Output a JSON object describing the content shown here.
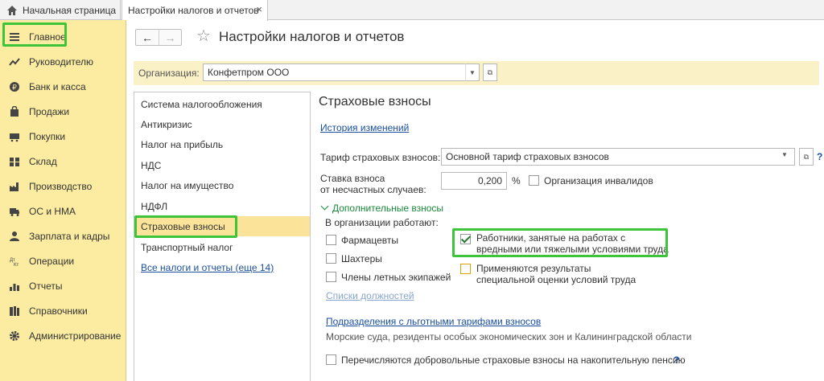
{
  "tabs": {
    "home_label": "Начальная страница",
    "active_label": "Настройки налогов и отчетов",
    "close_glyph": "×"
  },
  "sidebar": {
    "items": [
      {
        "label": "Главное",
        "icon": "menu-lines-icon"
      },
      {
        "label": "Руководителю",
        "icon": "trend-icon"
      },
      {
        "label": "Банк и касса",
        "icon": "coin-icon"
      },
      {
        "label": "Продажи",
        "icon": "bag-icon"
      },
      {
        "label": "Покупки",
        "icon": "cart-icon"
      },
      {
        "label": "Склад",
        "icon": "warehouse-icon"
      },
      {
        "label": "Производство",
        "icon": "factory-icon"
      },
      {
        "label": "ОС и НМА",
        "icon": "truck-icon"
      },
      {
        "label": "Зарплата и кадры",
        "icon": "person-icon"
      },
      {
        "label": "Операции",
        "icon": "operations-icon"
      },
      {
        "label": "Отчеты",
        "icon": "bar-chart-icon"
      },
      {
        "label": "Справочники",
        "icon": "books-icon"
      },
      {
        "label": "Администрирование",
        "icon": "gear-icon"
      }
    ]
  },
  "header": {
    "back_glyph": "←",
    "forward_glyph": "→",
    "star_glyph": "☆",
    "title": "Настройки налогов и отчетов"
  },
  "org": {
    "label": "Организация:",
    "value": "Конфетпром ООО",
    "drop_glyph": "▼",
    "open_glyph": "⧉"
  },
  "sections": {
    "items": [
      "Система налогообложения",
      "Антикризис",
      "Налог на прибыль",
      "НДС",
      "Налог на имущество",
      "НДФЛ",
      "Страховые взносы",
      "Транспортный налог"
    ],
    "all_link": "Все налоги и отчеты (еще 14)",
    "active_index": 6
  },
  "content": {
    "title": "Страховые взносы",
    "history_link": "История изменений",
    "tariff_label": "Тариф страховых взносов:",
    "tariff_value": "Основной тариф страховых взносов",
    "rate_label_1": "Ставка взноса",
    "rate_label_2": "от несчастных случаев:",
    "rate_value": "0,200",
    "rate_unit": "%",
    "disabled_org_label": "Организация инвалидов",
    "disabled_org_checked": false,
    "extra_header": "Дополнительные взносы",
    "works_label": "В организации работают:",
    "left_checks": [
      {
        "label": "Фармацевты",
        "checked": false
      },
      {
        "label": "Шахтеры",
        "checked": false
      },
      {
        "label": "Члены летных экипажей",
        "checked": false
      }
    ],
    "hazard_label_1": "Работники, занятые на работах с",
    "hazard_label_2": "вредными или тяжелыми условиями труда",
    "hazard_checked": true,
    "assess_label_1": "Применяются результаты",
    "assess_label_2": "специальной оценки условий труда",
    "assess_checked": false,
    "positions_link": "Списки должностей",
    "subdiv_link": "Подразделения с льготными тарифами взносов",
    "subdiv_note": "Морские суда, резиденты особых экономических зон и Калининградской области",
    "voluntary_label": "Перечисляются добровольные страховые взносы на накопительную пенсию",
    "voluntary_checked": false,
    "help_glyph": "?"
  },
  "colors": {
    "sidebar_bg": "#fbeca2",
    "highlight_green": "#3ec43b",
    "link_blue": "#1a4fa0",
    "active_section": "#fbe49a"
  }
}
